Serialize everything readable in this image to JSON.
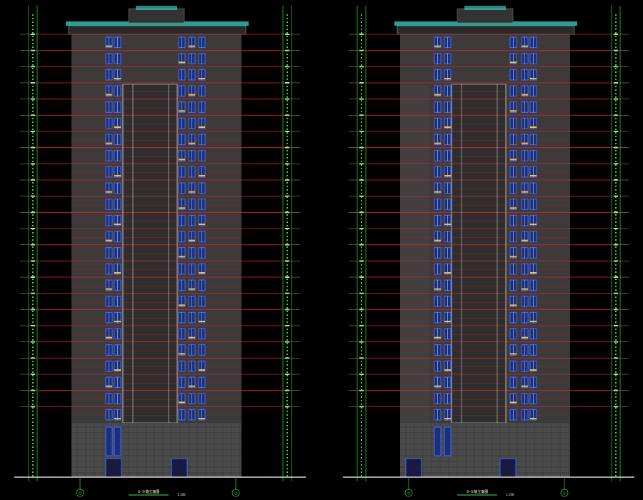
{
  "drawing": {
    "background": "#000000",
    "colors": {
      "wall": "#3b3b3b",
      "wall_dark": "#2e2e2e",
      "floor_line": "#e0202a",
      "window_frame": "#3a6fff",
      "window_glass": "#1d2f7a",
      "window_white": "#e8e8ff",
      "railing": "#f0c040",
      "dimension": "#22cc22",
      "axis_line": "#ffffff",
      "roof_trim": "#40e0d0",
      "base": "#4a4a4a",
      "grid_axis": "#30c030"
    },
    "elevations": [
      {
        "id": "left",
        "title": "①-⑦轴立面图",
        "scale": "1:100",
        "axis_start": "①",
        "axis_end": "⑦",
        "labels": [
          "①",
          "⑦"
        ]
      },
      {
        "id": "right",
        "title": "⑦-①轴立面图",
        "scale": "1:100",
        "axis_start": "⑦",
        "axis_end": "①",
        "labels": [
          "⑦",
          "①"
        ]
      }
    ],
    "floors": 24
  }
}
